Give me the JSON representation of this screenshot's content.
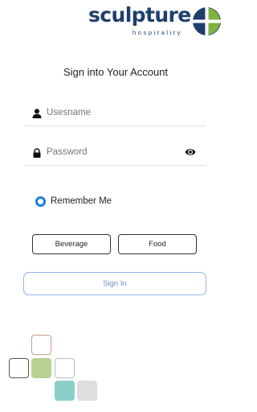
{
  "logo": {
    "brand": "sculpture",
    "subtitle": "hospitality",
    "icon": "sculpture-logo-mark"
  },
  "title": "Sign into Your Account",
  "username": {
    "icon": "user-icon",
    "placeholder": "Usesname"
  },
  "password": {
    "icon": "lock-icon",
    "placeholder": "Password",
    "toggle_icon": "eye-icon"
  },
  "remember": {
    "label": "Remember Me",
    "checked": true
  },
  "categories": {
    "beverage": "Beverage",
    "food": "Food"
  },
  "signin": {
    "label": "Sign In"
  },
  "colors": {
    "brand_navy": "#1f3f6b",
    "brand_green": "#7fb241",
    "accent_blue": "#1e7be0",
    "signin_border": "#8fb4ea"
  }
}
